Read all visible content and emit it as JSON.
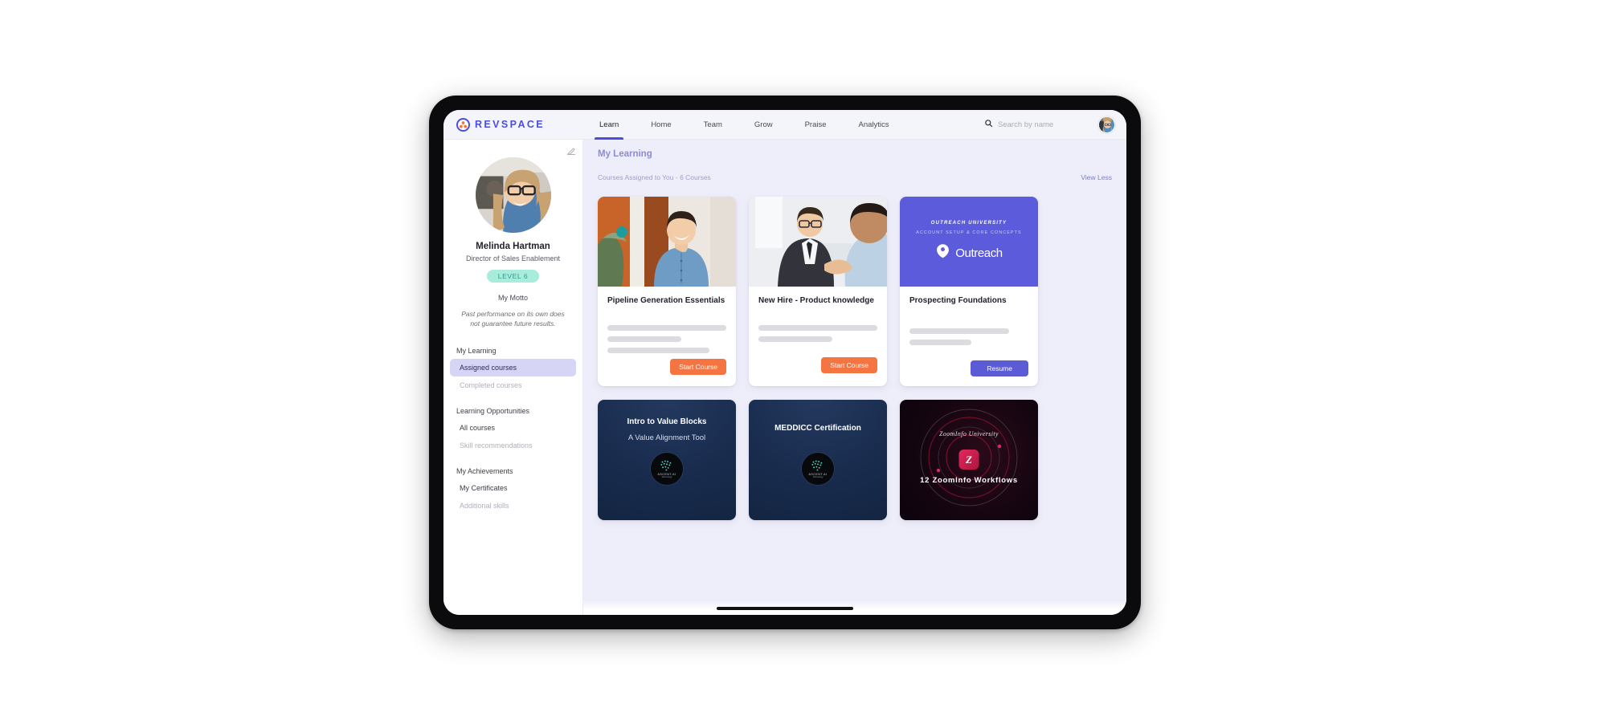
{
  "brand": {
    "name": "REVSPACE",
    "logo_icon": "revspace-logo-icon",
    "accent": "#4c4ddc"
  },
  "nav": {
    "tabs": [
      {
        "label": "Learn",
        "active": true
      },
      {
        "label": "Home",
        "active": false
      },
      {
        "label": "Team",
        "active": false
      },
      {
        "label": "Grow",
        "active": false
      },
      {
        "label": "Praise",
        "active": false
      },
      {
        "label": "Analytics",
        "active": false
      }
    ]
  },
  "search": {
    "placeholder": "Search by name",
    "value": "",
    "icon": "search-icon"
  },
  "topbar_avatar": {
    "icon": "avatar",
    "alt": "Melinda Hartman"
  },
  "profile": {
    "edit_icon": "edit-pencil-icon",
    "name": "Melinda Hartman",
    "role": "Director of Sales Enablement",
    "level_badge": "LEVEL 6",
    "level_badge_bg": "#a8ecdc",
    "level_badge_color": "#2f9b8b",
    "motto_label": "My Motto",
    "motto_text": "Past performance on its own does not guarantee future results."
  },
  "sidebar": {
    "groups": [
      {
        "title": "My Learning",
        "items": [
          {
            "label": "Assigned courses",
            "state": "active"
          },
          {
            "label": "Completed courses",
            "state": "muted"
          }
        ]
      },
      {
        "title": "Learning Opportunities",
        "items": [
          {
            "label": "All courses",
            "state": "normal"
          },
          {
            "label": "Skill recommendations",
            "state": "muted"
          }
        ]
      },
      {
        "title": "My Achievements",
        "items": [
          {
            "label": "My Certificates",
            "state": "normal"
          },
          {
            "label": "Additional skills",
            "state": "muted"
          }
        ]
      }
    ]
  },
  "main": {
    "title": "My Learning",
    "subhead": "Courses Assigned to You - 6 Courses",
    "view_toggle": "View Less",
    "bg": "#eeeefa",
    "courses_row1": [
      {
        "title": "Pipeline Generation Essentials",
        "cta": "Start Course",
        "cta_style": "orange",
        "thumb": "photo-man-blue-shirt",
        "skeleton_widths": [
          100,
          62,
          86
        ]
      },
      {
        "title": "New Hire - Product knowledge",
        "cta": "Start Course",
        "cta_style": "orange",
        "thumb": "photo-handshake-suit",
        "skeleton_widths": [
          100,
          62
        ]
      },
      {
        "title": "Prospecting Foundations",
        "cta": "Resume",
        "cta_style": "purple",
        "thumb": "outreach-brand-tile",
        "thumb_bg": "#5b5bdc",
        "thumb_eyebrow": "OUTREACH UNIVERSITY",
        "thumb_subline": "ACCOUNT SETUP & CORE CONCEPTS",
        "thumb_wordmark": "Outreach",
        "skeleton_widths": [
          84,
          52
        ]
      }
    ],
    "courses_row2": [
      {
        "kind": "navy",
        "title": "Intro to Value Blocks",
        "subtitle": "A Value Alignment Tool",
        "badge_name": "ASCENT.AI",
        "badge_sub": "Technology"
      },
      {
        "kind": "navy",
        "title": "MEDDICC Certification",
        "subtitle": "",
        "badge_name": "ASCENT.AI",
        "badge_sub": "Technology"
      },
      {
        "kind": "zoominfo",
        "brand_script": "ZoomInfo University",
        "logo_letter": "Z",
        "title": "12 ZoomInfo Workflows"
      }
    ]
  },
  "device": {
    "home_indicator": true
  }
}
